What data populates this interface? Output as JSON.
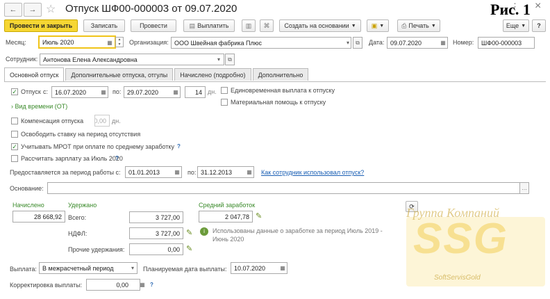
{
  "header": {
    "title": "Отпуск ШФ00-000003 от 09.07.2020",
    "figure_label": "Рис. 1",
    "more_glyph": "⋮",
    "close_glyph": "×"
  },
  "toolbar": {
    "post_close": "Провести и закрыть",
    "save": "Записать",
    "post": "Провести",
    "pay": "Выплатить",
    "create_based": "Создать на основании",
    "print": "Печать",
    "more": "Еще"
  },
  "form": {
    "month_label": "Месяц:",
    "month_value": "Июль 2020",
    "org_label": "Организация:",
    "org_value": "ООО Швейная фабрика Плюс",
    "date_label": "Дата:",
    "date_value": "09.07.2020",
    "number_label": "Номер:",
    "number_value": "ШФ00-000003",
    "employee_label": "Сотрудник:",
    "employee_value": "Антонова Елена Александровна"
  },
  "tabs": [
    {
      "label": "Основной отпуск"
    },
    {
      "label": "Дополнительные отпуска, отгулы"
    },
    {
      "label": "Начислено (подробно)"
    },
    {
      "label": "Дополнительно"
    }
  ],
  "vacation": {
    "label": "Отпуск",
    "from_label": "с:",
    "from_value": "16.07.2020",
    "to_label": "по:",
    "to_value": "29.07.2020",
    "days_value": "14",
    "days_unit": "дн.",
    "lump_sum": "Единовременная выплата к отпуску",
    "material_aid": "Материальная помощь к отпуску",
    "time_type": "Вид времени (ОТ)",
    "compensation_label": "Компенсация отпуска",
    "compensation_value": "0,00",
    "compensation_unit": "дн.",
    "release_rate": "Освободить ставку на период отсутствия",
    "account_mrot": "Учитывать МРОТ при оплате по среднему заработку",
    "calc_salary": "Рассчитать зарплату за Июль 2020",
    "period_label": "Предоставляется за период работы с:",
    "period_from": "01.01.2013",
    "period_to_label": "по:",
    "period_to": "31.12.2013",
    "used_link": "Как сотрудник использовал отпуск?",
    "basis_label": "Основание:",
    "basis_value": ""
  },
  "totals": {
    "accrued_header": "Начислено",
    "accrued_value": "28 668,92",
    "withheld_header": "Удержано",
    "total_label": "Всего:",
    "total_value": "3 727,00",
    "ndfl_label": "НДФЛ:",
    "ndfl_value": "3 727,00",
    "other_label": "Прочие удержания:",
    "other_value": "0,00",
    "avg_header": "Средний заработок",
    "avg_value": "2 047,78",
    "avg_note": "Использованы данные о заработке за период Июль 2019 - Июнь 2020"
  },
  "payment": {
    "label": "Выплата:",
    "value": "В межрасчетный период",
    "planned_label": "Планируемая дата выплаты:",
    "planned_value": "10.07.2020",
    "correction_label": "Корректировка выплаты:",
    "correction_value": "0,00"
  },
  "watermark": {
    "line1": "Группа Компаний",
    "big": "SSG",
    "sub": "SoftServisGold"
  },
  "colors": {
    "primary_button": "#f6d633",
    "green_text": "#3a8a2a",
    "link": "#1a5fb4",
    "highlight_border": "#f0c419"
  }
}
